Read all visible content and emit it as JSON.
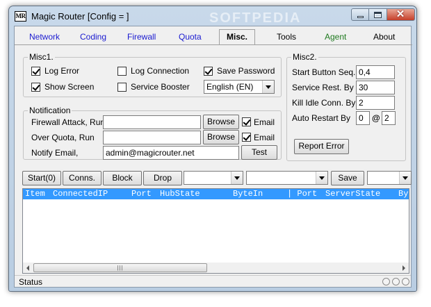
{
  "window": {
    "icon_text": "MR",
    "title": "Magic Router [Config = ]",
    "watermark": "SOFTPEDIA",
    "close_glyph": "✕"
  },
  "tabs": [
    {
      "label": "Network"
    },
    {
      "label": "Coding"
    },
    {
      "label": "Firewall"
    },
    {
      "label": "Quota"
    },
    {
      "label": "Misc.",
      "active": true
    },
    {
      "label": "Tools"
    },
    {
      "label": "Agent"
    },
    {
      "label": "About"
    }
  ],
  "misc1": {
    "label": "Misc1.",
    "log_error": {
      "label": "Log Error",
      "checked": true
    },
    "log_connection": {
      "label": "Log Connection",
      "checked": false
    },
    "save_password": {
      "label": "Save Password",
      "checked": true
    },
    "show_screen": {
      "label": "Show Screen",
      "checked": true
    },
    "service_booster": {
      "label": "Service Booster",
      "checked": false
    },
    "language": "English (EN)"
  },
  "notification": {
    "label": "Notification",
    "firewall_attack_label": "Firewall Attack, Run",
    "firewall_attack_value": "",
    "over_quota_label": "Over Quota, Run",
    "over_quota_value": "",
    "browse_label": "Browse",
    "email_label": "Email",
    "firewall_email_checked": true,
    "over_quota_email_checked": true,
    "notify_email_label": "Notify Email,",
    "notify_email_value": "admin@magicrouter.net",
    "test_label": "Test"
  },
  "misc2": {
    "label": "Misc2.",
    "start_button_seq_label": "Start Button Seq.",
    "start_button_seq_value": "0,4",
    "service_rest_label": "Service Rest. By",
    "service_rest_value": "30",
    "kill_idle_label": "Kill Idle Conn. By",
    "kill_idle_value": "2",
    "auto_restart_label": "Auto Restart By",
    "auto_restart_value1": "0",
    "auto_restart_at": "@",
    "auto_restart_value2": "2",
    "report_error_label": "Report Error"
  },
  "toolbar": {
    "start_label": "Start(0)",
    "conns_label": "Conns.",
    "block_label": "Block",
    "drop_label": "Drop",
    "save_label": "Save",
    "combo1_value": "",
    "combo2_value": "",
    "combo3_value": ""
  },
  "grid": {
    "columns": [
      "Item",
      "ConnectedIP",
      "Port",
      "HubState",
      "ByteIn",
      "| Port",
      "ServerState",
      "Byt"
    ],
    "rows": [],
    "thumb_grip": "|||"
  },
  "status": {
    "text": "Status"
  }
}
